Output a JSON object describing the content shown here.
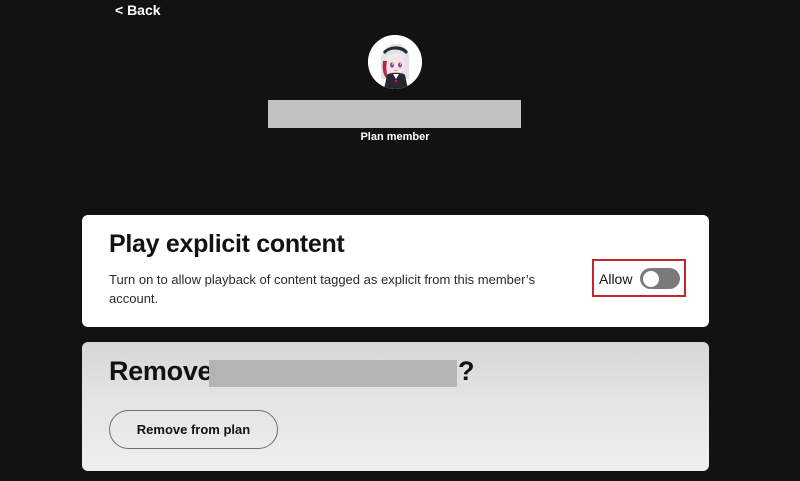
{
  "nav": {
    "back_label": "< Back"
  },
  "member": {
    "avatar_icon": "anime-avatar-icon",
    "role": "Plan member"
  },
  "explicit": {
    "title": "Play explicit content",
    "description": "Turn on to allow playback of content tagged as explicit from this member’s account.",
    "toggle_label": "Allow",
    "toggle_on": false,
    "highlight_color": "#c1272d"
  },
  "remove": {
    "title_prefix": "Remove",
    "title_suffix": "?",
    "button_label": "Remove from plan"
  },
  "colors": {
    "background": "#121212",
    "card": "#ffffff",
    "toggle_off": "#7a7a7a",
    "redaction": "#c2c2c2"
  }
}
